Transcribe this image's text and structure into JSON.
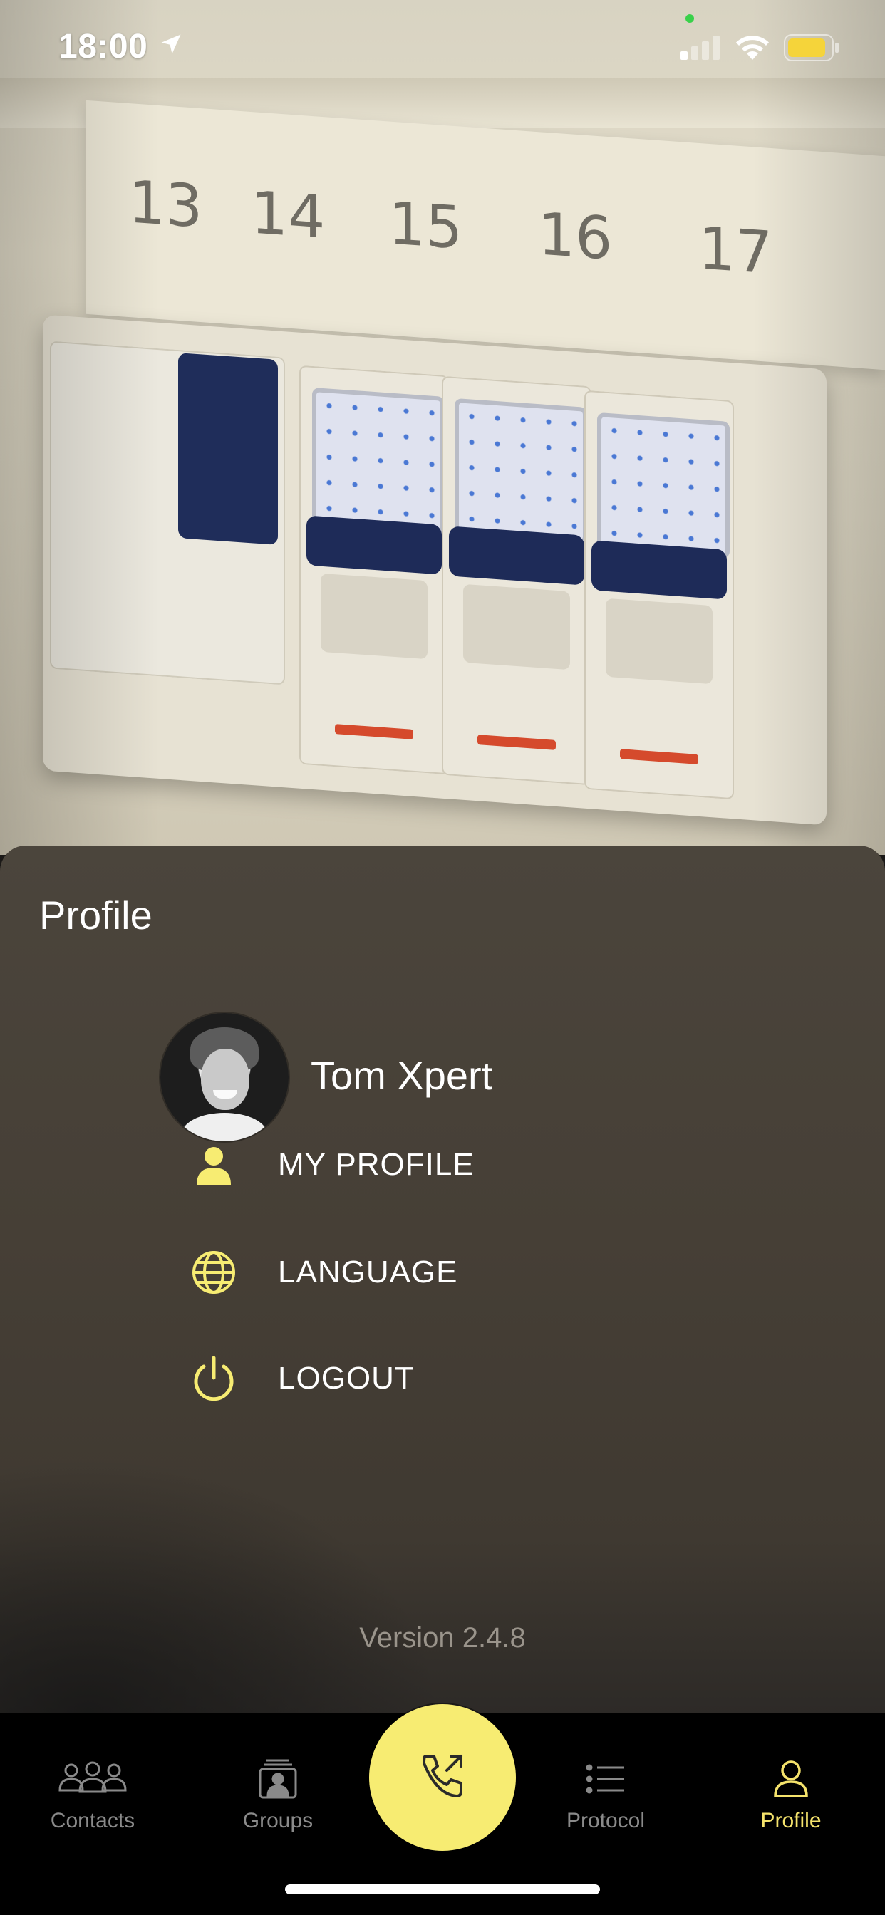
{
  "status_bar": {
    "time": "18:00"
  },
  "background": {
    "breaker_numbers": [
      "13",
      "14",
      "15",
      "16",
      "17"
    ]
  },
  "profile_sheet": {
    "title": "Profile",
    "user_name": "Tom Xpert",
    "menu": [
      {
        "label": "MY PROFILE",
        "icon": "person-icon"
      },
      {
        "label": "LANGUAGE",
        "icon": "globe-icon"
      },
      {
        "label": "LOGOUT",
        "icon": "power-icon"
      }
    ],
    "version": "Version 2.4.8"
  },
  "tab_bar": {
    "tabs": [
      {
        "label": "Contacts",
        "icon": "contacts-icon",
        "active": false
      },
      {
        "label": "Groups",
        "icon": "groups-icon",
        "active": false
      },
      {
        "label": "Protocol",
        "icon": "list-icon",
        "active": false
      },
      {
        "label": "Profile",
        "icon": "profile-icon",
        "active": true
      }
    ],
    "call_icon": "outgoing-call-icon"
  },
  "colors": {
    "accent": "#f7ec72",
    "active_tab": "#f5e36c",
    "sheet": "#463f36",
    "tabbar": "#000000"
  }
}
